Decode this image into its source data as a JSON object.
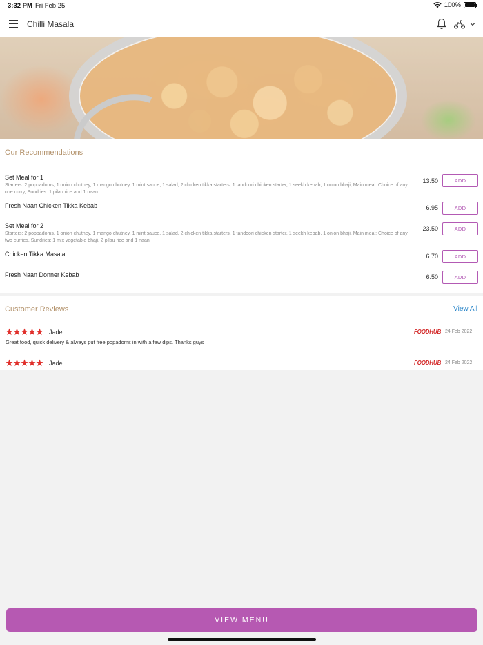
{
  "status_bar": {
    "time": "3:32 PM",
    "date": "Fri Feb 25",
    "battery": "100%"
  },
  "header": {
    "title": "Chilli Masala",
    "icons": [
      "menu-icon",
      "bell-icon",
      "scooter-icon",
      "chevron-down-icon"
    ]
  },
  "recommendations": {
    "title": "Our Recommendations",
    "add_label": "ADD",
    "items": [
      {
        "name": "Set Meal for 1",
        "description": "Starters: 2 poppadoms, 1 onion chutney, 1 mango chutney, 1 mint sauce, 1 salad, 2 chicken tikka starters, 1 tandoori chicken starter, 1 seekh kebab, 1 onion bhaji, Main meal: Choice of any one curry, Sundries: 1 pilau rice and 1 naan",
        "price": "13.50"
      },
      {
        "name": "Fresh Naan Chicken Tikka Kebab",
        "description": "",
        "price": "6.95"
      },
      {
        "name": "Set Meal for 2",
        "description": "Starters: 2 poppadoms, 1 onion chutney, 1 mango chutney, 1 mint sauce, 1 salad, 2 chicken tikka starters, 1 tandoori chicken starter, 1 seekh kebab, 1 onion bhaji, Main meal: Choice of any two curries, Sundries: 1 mix vegetable bhaji, 2 pilau rice and 1 naan",
        "price": "23.50"
      },
      {
        "name": "Chicken Tikka Masala",
        "description": "",
        "price": "6.70"
      },
      {
        "name": "Fresh Naan Donner Kebab",
        "description": "",
        "price": "6.50"
      }
    ]
  },
  "reviews": {
    "title": "Customer Reviews",
    "view_all": "View All",
    "items": [
      {
        "rating": 5,
        "name": "Jade",
        "source": "FOODHUB",
        "date": "24 Feb 2022",
        "text": "Great food, quick delivery & always put free popadoms in with a few dips. Thanks guys"
      },
      {
        "rating": 5,
        "name": "Jade",
        "source": "FOODHUB",
        "date": "24 Feb 2022",
        "text": ""
      }
    ]
  },
  "view_menu_label": "VIEW MENU",
  "colors": {
    "accent": "#b659b2",
    "section_title": "#b3926b",
    "link": "#2a86c9",
    "star": "#e0302c",
    "foodhub": "#d32a2a"
  }
}
